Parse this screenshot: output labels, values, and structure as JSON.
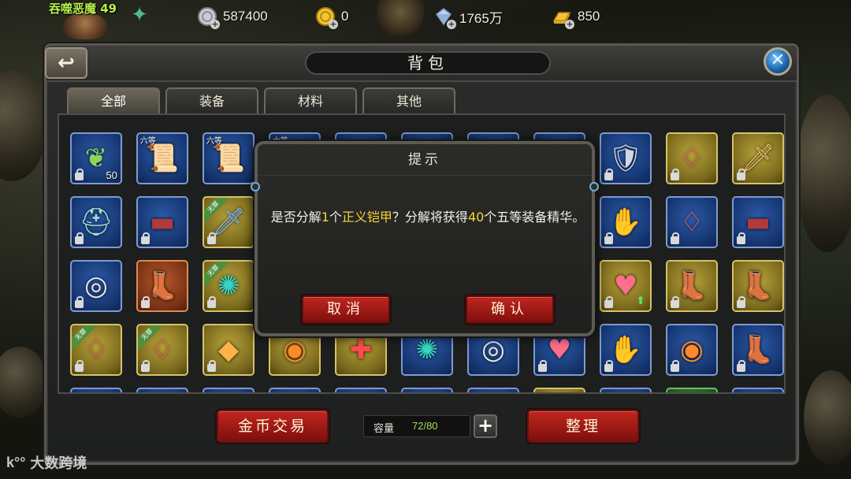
{
  "hud": {
    "player_name": "吞噬恶魔 49",
    "currencies": [
      {
        "icon": "silver-coin-icon",
        "value": "587400"
      },
      {
        "icon": "gold-coin-icon",
        "value": "0"
      },
      {
        "icon": "diamond-icon",
        "value": "1765万"
      },
      {
        "icon": "gold-bar-icon",
        "value": "850"
      }
    ]
  },
  "panel": {
    "title": "背包",
    "tabs": [
      "全部",
      "装备",
      "材料",
      "其他"
    ],
    "active_tab": "全部"
  },
  "items": [
    {
      "icon": "herb-branch-icon",
      "q": "blue",
      "lock": true,
      "count": "50"
    },
    {
      "icon": "scroll-icon",
      "q": "blue",
      "grade": "六等"
    },
    {
      "icon": "scroll-icon",
      "q": "blue",
      "grade": "六等"
    },
    {
      "icon": "scroll-icon",
      "q": "blue",
      "grade": "六等"
    },
    {
      "icon": "item-icon",
      "q": "blue"
    },
    {
      "icon": "item-icon",
      "q": "blue"
    },
    {
      "icon": "item-icon",
      "q": "blue"
    },
    {
      "icon": "item-icon",
      "q": "blue"
    },
    {
      "icon": "armor-icon",
      "q": "blue",
      "lock": true
    },
    {
      "icon": "earring-icon",
      "q": "gold",
      "lock": true
    },
    {
      "icon": "sword-icon",
      "q": "gold",
      "lock": true
    },
    {
      "icon": "helmet-icon",
      "q": "blue",
      "lock": true
    },
    {
      "icon": "belt-icon",
      "q": "blue",
      "lock": true
    },
    {
      "icon": "dagger-icon",
      "q": "gold",
      "lock": true,
      "ribbon": "无罪"
    },
    {
      "icon": "item-icon",
      "q": "blue"
    },
    {
      "icon": "item-icon",
      "q": "blue"
    },
    {
      "icon": "item-icon",
      "q": "blue"
    },
    {
      "icon": "item-icon",
      "q": "blue"
    },
    {
      "icon": "item-icon",
      "q": "blue"
    },
    {
      "icon": "gauntlet-icon",
      "q": "blue",
      "lock": true
    },
    {
      "icon": "earring-icon",
      "q": "blue",
      "lock": true
    },
    {
      "icon": "belt-icon",
      "q": "blue",
      "lock": true
    },
    {
      "icon": "ring-icon",
      "q": "blue",
      "lock": true
    },
    {
      "icon": "boots-icon",
      "q": "orange",
      "lock": true
    },
    {
      "icon": "mace-icon",
      "q": "gold",
      "lock": true,
      "ribbon": "无罪"
    },
    {
      "icon": "item-icon",
      "q": "blue"
    },
    {
      "icon": "item-icon",
      "q": "blue"
    },
    {
      "icon": "item-icon",
      "q": "blue"
    },
    {
      "icon": "item-icon",
      "q": "blue"
    },
    {
      "icon": "item-icon",
      "q": "blue"
    },
    {
      "icon": "necklace-icon",
      "q": "gold",
      "lock": true,
      "up": true
    },
    {
      "icon": "boots-icon",
      "q": "gold",
      "lock": true
    },
    {
      "icon": "boots-icon",
      "q": "gold",
      "lock": true
    },
    {
      "icon": "earring-icon",
      "q": "gold",
      "lock": true,
      "ribbon": "无罪"
    },
    {
      "icon": "earring-icon",
      "q": "gold",
      "lock": true,
      "ribbon": "无罪"
    },
    {
      "icon": "pendant-icon",
      "q": "gold",
      "lock": true
    },
    {
      "icon": "bracelet-icon",
      "q": "gold"
    },
    {
      "icon": "chest-armor-icon",
      "q": "gold"
    },
    {
      "icon": "mace-icon",
      "q": "blue"
    },
    {
      "icon": "ring-icon",
      "q": "blue"
    },
    {
      "icon": "necklace-icon",
      "q": "blue",
      "lock": true
    },
    {
      "icon": "gauntlet-icon",
      "q": "blue",
      "lock": true
    },
    {
      "icon": "bracelet-icon",
      "q": "blue",
      "lock": true
    },
    {
      "icon": "boots-icon",
      "q": "blue",
      "lock": true
    },
    {
      "icon": "item-icon",
      "q": "blue"
    },
    {
      "icon": "item-icon",
      "q": "blue"
    },
    {
      "icon": "item-icon",
      "q": "blue"
    },
    {
      "icon": "item-icon",
      "q": "blue"
    },
    {
      "icon": "item-icon",
      "q": "blue"
    },
    {
      "icon": "item-icon",
      "q": "blue"
    },
    {
      "icon": "item-icon",
      "q": "blue"
    },
    {
      "icon": "item-icon",
      "q": "gold"
    },
    {
      "icon": "item-icon",
      "q": "blue"
    },
    {
      "icon": "item-icon",
      "q": "green"
    },
    {
      "icon": "item-icon",
      "q": "blue"
    }
  ],
  "footer": {
    "gold_trade": "金币交易",
    "capacity_label": "容量",
    "capacity_value": "72/80",
    "sort": "整理"
  },
  "dialog": {
    "title": "提示",
    "msg_part1": "是否分解",
    "msg_count1": "1",
    "msg_part2": "个",
    "msg_item": "正义铠甲",
    "msg_part3": "？分解将获得",
    "msg_count2": "40",
    "msg_part4": "个五等装备精华。",
    "cancel": "取消",
    "confirm": "确认"
  },
  "watermark": "大数跨境"
}
